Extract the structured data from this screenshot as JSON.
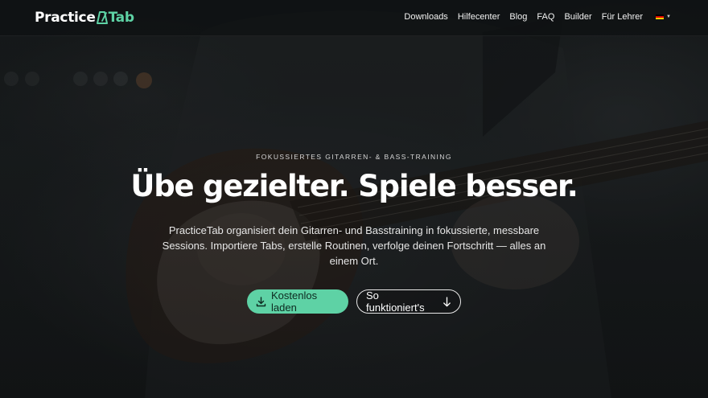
{
  "brand": {
    "name_part1": "Practice",
    "name_part2": "Tab",
    "accent_color": "#5ed2a5",
    "logo_icon": "metronome-icon"
  },
  "nav": {
    "links": [
      {
        "label": "Downloads"
      },
      {
        "label": "Hilfecenter"
      },
      {
        "label": "Blog"
      },
      {
        "label": "FAQ"
      },
      {
        "label": "Builder"
      },
      {
        "label": "Für Lehrer"
      }
    ],
    "language_icon": "german-flag-icon"
  },
  "hero": {
    "eyebrow": "FOKUSSIERTES GITARREN- & BASS-TRAINING",
    "headline": "Übe gezielter. Spiele besser.",
    "lead": "PracticeTab organisiert dein Gitarren- und Basstraining in fokussierte, messbare Sessions. Importiere Tabs, erstelle Routinen, verfolge deinen Fortschritt — alles an einem Ort.",
    "primary_cta": "Kostenlos laden",
    "primary_cta_icon": "download-icon",
    "secondary_cta": "So funktioniert's",
    "secondary_cta_icon": "arrow-down-icon",
    "background": "guitarist-photo"
  }
}
